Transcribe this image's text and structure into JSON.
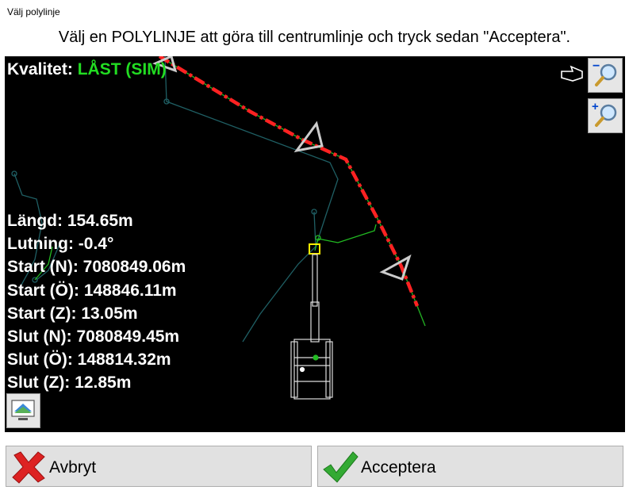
{
  "window": {
    "title": "Välj polylinje"
  },
  "instruction": "Välj en POLYLINJE att göra till centrumlinje och tryck sedan \"Acceptera\".",
  "quality": {
    "label": "Kvalitet:",
    "value": "LÅST (SIM)"
  },
  "stats": [
    "Längd: 154.65m",
    "Lutning: -0.4°",
    "Start (N): 7080849.06m",
    "Start (Ö): 148846.11m",
    "Start (Z): 13.05m",
    "Slut (N): 7080849.45m",
    "Slut (Ö): 148814.32m",
    "Slut (Z): 12.85m"
  ],
  "toolbar": {
    "zoom_out_icon": "zoom-out-icon",
    "zoom_in_icon": "zoom-in-icon",
    "layers_icon": "layers-icon"
  },
  "buttons": {
    "cancel": "Avbryt",
    "accept": "Acceptera"
  },
  "colors": {
    "selected_line": "#ff2222",
    "gps_quality": "#22dd22",
    "map_background": "#000000"
  }
}
